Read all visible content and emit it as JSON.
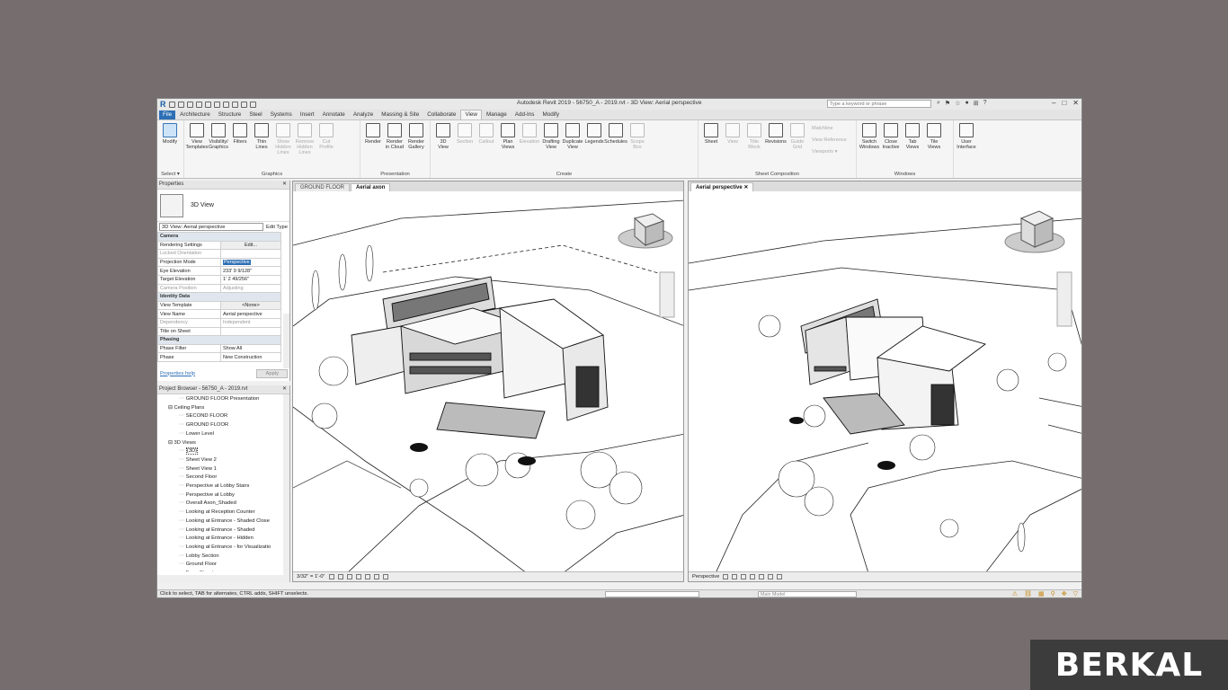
{
  "app": {
    "title": "Autodesk Revit 2019 - 56750_A - 2019.rvt - 3D View: Aerial perspective",
    "search_placeholder": "Type a keyword or phrase"
  },
  "tabs": [
    "File",
    "Architecture",
    "Structure",
    "Steel",
    "Systems",
    "Insert",
    "Annotate",
    "Analyze",
    "Massing & Site",
    "Collaborate",
    "View",
    "Manage",
    "Add-Ins",
    "Modify"
  ],
  "ribbon": {
    "select": {
      "modify": "Modify",
      "label": "Select ▾"
    },
    "graphics": {
      "label": "Graphics",
      "buttons": [
        {
          "l1": "View",
          "l2": "Templates",
          "dis": false
        },
        {
          "l1": "Visibility/",
          "l2": "Graphics",
          "dis": false
        },
        {
          "l1": "Filters",
          "l2": "",
          "dis": false
        },
        {
          "l1": "Thin",
          "l2": "Lines",
          "dis": false
        },
        {
          "l1": "Show",
          "l2": "Hidden Lines",
          "dis": true
        },
        {
          "l1": "Remove",
          "l2": "Hidden Lines",
          "dis": true
        },
        {
          "l1": "Cut",
          "l2": "Profile",
          "dis": true
        }
      ]
    },
    "presentation": {
      "label": "Presentation",
      "buttons": [
        {
          "l1": "Render",
          "l2": "",
          "dis": false
        },
        {
          "l1": "Render",
          "l2": "in Cloud",
          "dis": false
        },
        {
          "l1": "Render",
          "l2": "Gallery",
          "dis": false
        }
      ]
    },
    "create": {
      "label": "Create",
      "buttons": [
        {
          "l1": "3D",
          "l2": "View",
          "dis": false
        },
        {
          "l1": "Section",
          "l2": "",
          "dis": true
        },
        {
          "l1": "Callout",
          "l2": "",
          "dis": true
        },
        {
          "l1": "Plan",
          "l2": "Views",
          "dis": false
        },
        {
          "l1": "Elevation",
          "l2": "",
          "dis": true
        },
        {
          "l1": "Drafting",
          "l2": "View",
          "dis": false
        },
        {
          "l1": "Duplicate",
          "l2": "View",
          "dis": false
        },
        {
          "l1": "Legends",
          "l2": "",
          "dis": false
        },
        {
          "l1": "Schedules",
          "l2": "",
          "dis": false
        },
        {
          "l1": "Scope",
          "l2": "Box",
          "dis": true
        }
      ]
    },
    "sheet": {
      "label": "Sheet Composition",
      "buttons": [
        {
          "l1": "Sheet",
          "l2": "",
          "dis": false
        },
        {
          "l1": "View",
          "l2": "",
          "dis": true
        },
        {
          "l1": "Title",
          "l2": "Block",
          "dis": true
        },
        {
          "l1": "Revisions",
          "l2": "",
          "dis": false
        },
        {
          "l1": "Guide",
          "l2": "Grid",
          "dis": true
        }
      ],
      "small": [
        "Matchline",
        "View Reference",
        "Viewports ▾"
      ]
    },
    "windows": {
      "label": "Windows",
      "buttons": [
        {
          "l1": "Switch",
          "l2": "Windows",
          "dis": false
        },
        {
          "l1": "Close",
          "l2": "Inactive",
          "dis": false
        },
        {
          "l1": "Tab",
          "l2": "Views",
          "dis": false
        },
        {
          "l1": "Tile",
          "l2": "Views",
          "dis": false
        }
      ]
    },
    "ui": {
      "l1": "User",
      "l2": "Interface"
    }
  },
  "properties": {
    "header": "Properties",
    "type_name": "3D View",
    "instance": "3D View: Aerial perspective",
    "edit_type": "Edit Type",
    "rows": [
      {
        "k": "Camera",
        "v": "",
        "cat": true
      },
      {
        "k": "Rendering Settings",
        "v": "Edit...",
        "btn": true
      },
      {
        "k": "Locked Orientation",
        "v": "",
        "grey": true
      },
      {
        "k": "Projection Mode",
        "v": "Perspective",
        "hl": true
      },
      {
        "k": "Eye Elevation",
        "v": "233' 9 9/128\""
      },
      {
        "k": "Target Elevation",
        "v": "1' 2 49/256\""
      },
      {
        "k": "Camera Position",
        "v": "Adjusting",
        "grey": true
      },
      {
        "k": "Identity Data",
        "v": "",
        "cat": true
      },
      {
        "k": "View Template",
        "v": "<None>",
        "btn": true
      },
      {
        "k": "View Name",
        "v": "Aerial perspective"
      },
      {
        "k": "Dependency",
        "v": "Independent",
        "grey": true
      },
      {
        "k": "Title on Sheet",
        "v": ""
      },
      {
        "k": "Phasing",
        "v": "",
        "cat": true
      },
      {
        "k": "Phase Filter",
        "v": "Show All"
      },
      {
        "k": "Phase",
        "v": "New Construction"
      }
    ],
    "help": "Properties help",
    "apply": "Apply"
  },
  "browser": {
    "header": "Project Browser - 56750_A - 2019.rvt",
    "items": [
      {
        "t": "GROUND FLOOR Presentation",
        "lv": 2
      },
      {
        "t": "Ceiling Plans",
        "lv": 1
      },
      {
        "t": "SECOND FLOOR",
        "lv": 2
      },
      {
        "t": "GROUND FLOOR",
        "lv": 2
      },
      {
        "t": "Lower Level",
        "lv": 2
      },
      {
        "t": "3D Views",
        "lv": 1
      },
      {
        "t": "{3D}",
        "lv": 2,
        "sel": true
      },
      {
        "t": "Sheet View 2",
        "lv": 2
      },
      {
        "t": "Sheet View 1",
        "lv": 2
      },
      {
        "t": "Second Floor",
        "lv": 2
      },
      {
        "t": "Perspective at Lobby Stairs",
        "lv": 2
      },
      {
        "t": "Perspective at Lobby",
        "lv": 2
      },
      {
        "t": "Overall Axon_Shaded",
        "lv": 2
      },
      {
        "t": "Looking at Reception Counter",
        "lv": 2
      },
      {
        "t": "Looking at Entrance - Shaded Close",
        "lv": 2
      },
      {
        "t": "Looking at Entrance - Shaded",
        "lv": 2
      },
      {
        "t": "Looking at Entrance - Hidden",
        "lv": 2
      },
      {
        "t": "Looking at Entrance - for Visualizatio",
        "lv": 2
      },
      {
        "t": "Lobby Section",
        "lv": 2
      },
      {
        "t": "Ground Floor",
        "lv": 2
      },
      {
        "t": "From Street",
        "lv": 2
      }
    ]
  },
  "views": {
    "left_tabs": [
      "GROUND FLOOR",
      "Aerial axon"
    ],
    "left_scale": "3/32\" = 1'-0\"",
    "right_tab": "Aerial perspective",
    "right_mode": "Perspective"
  },
  "status": {
    "hint": "Click to select, TAB for alternates, CTRL adds, SHIFT unselects.",
    "model": "Main Model"
  },
  "brand": "BERKAL"
}
